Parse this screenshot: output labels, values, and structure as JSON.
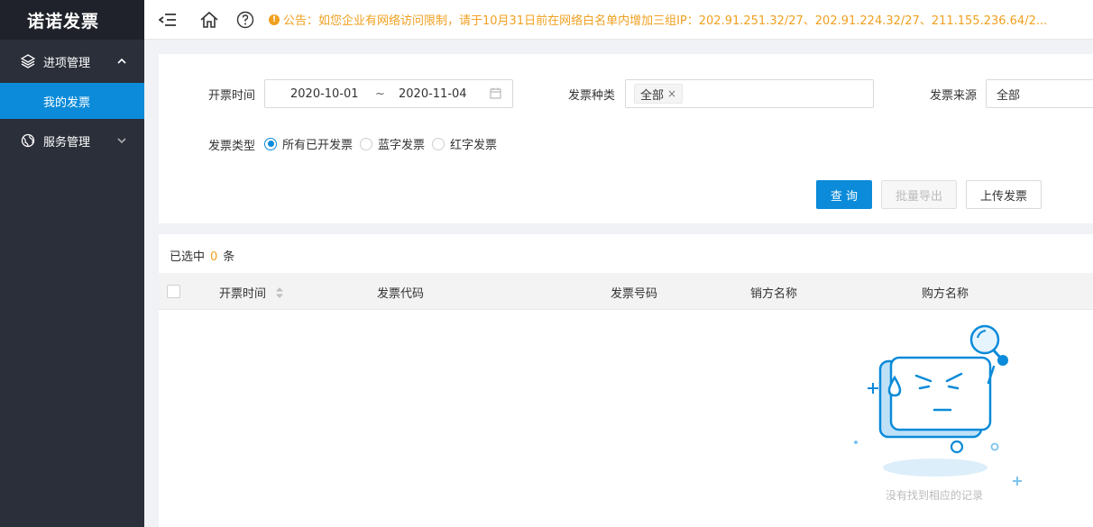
{
  "app": {
    "logo": "诺诺发票"
  },
  "sidebar": {
    "groups": [
      {
        "label": "进项管理",
        "icon": "layers-icon",
        "expanded": true
      },
      {
        "label": "服务管理",
        "icon": "globe-icon",
        "expanded": false
      }
    ],
    "active_item": "我的发票"
  },
  "header": {
    "notice": "公告：如您企业有网络访问限制，请于10月31日前在网络白名单内增加三组IP：202.91.251.32/27、202.91.224.32/27、211.155.236.64/2...",
    "notice_color": "#f0a020"
  },
  "filters": {
    "date": {
      "label": "开票时间",
      "start": "2020-10-01",
      "separator": "~",
      "end": "2020-11-04"
    },
    "invoice_kind": {
      "label": "发票种类",
      "tag": "全部"
    },
    "invoice_source": {
      "label": "发票来源",
      "value": "全部"
    },
    "invoice_type": {
      "label": "发票类型",
      "options": [
        "所有已开发票",
        "蓝字发票",
        "红字发票"
      ],
      "selected": "所有已开发票"
    }
  },
  "actions": {
    "query": "查 询",
    "export": "批量导出",
    "upload": "上传发票"
  },
  "table": {
    "selected_prefix": "已选中",
    "selected_count": "0",
    "selected_suffix": "条",
    "columns": [
      "开票时间",
      "发票代码",
      "发票号码",
      "销方名称",
      "购方名称"
    ],
    "rows": [],
    "empty_text": "没有找到相应的记录"
  },
  "colors": {
    "primary": "#0b8bd9",
    "sidebar_bg": "#2b2f3a",
    "accent": "#f0a020"
  }
}
